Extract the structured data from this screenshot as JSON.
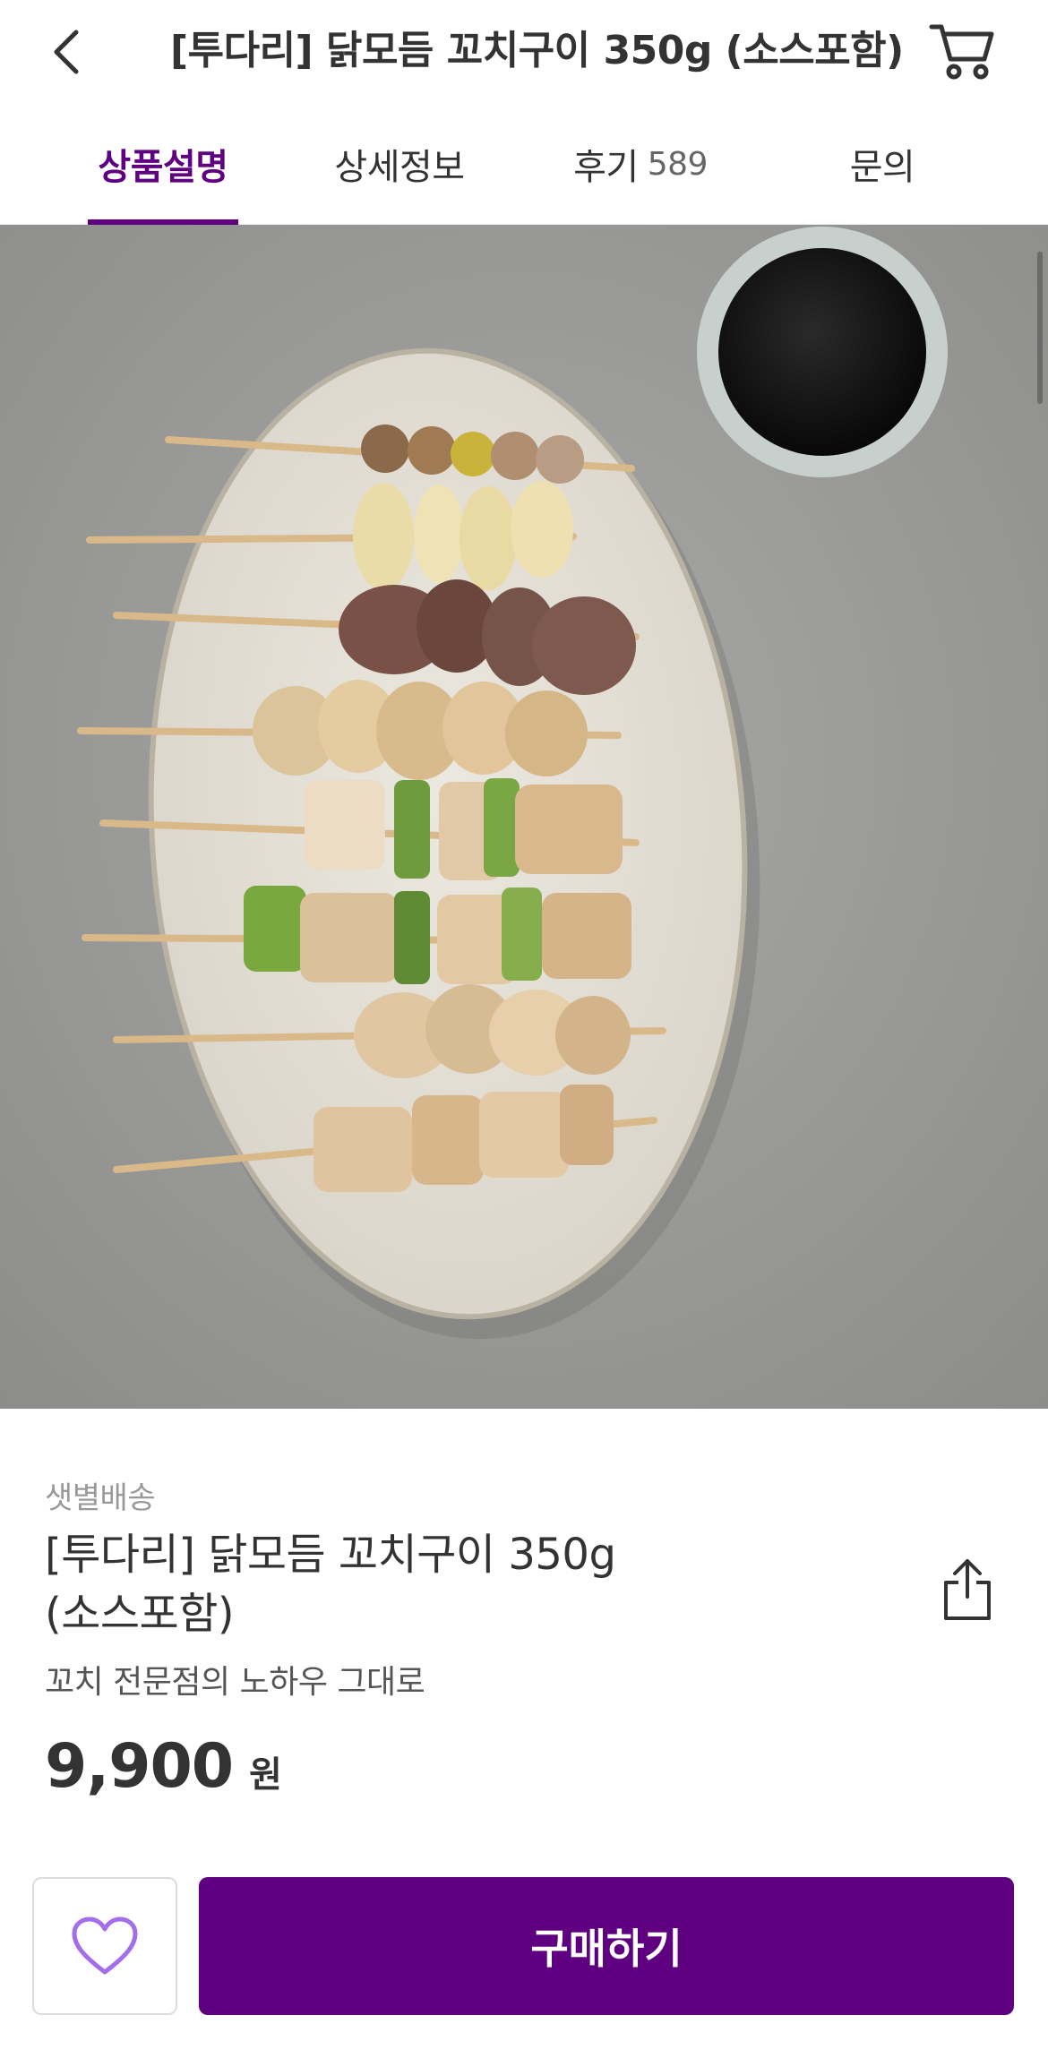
{
  "header": {
    "title": "[투다리] 닭모듬 꼬치구이 350g (소스포함)",
    "back_icon": "chevron-left-icon",
    "cart_icon": "cart-icon"
  },
  "tabs": [
    {
      "label": "상품설명",
      "active": true
    },
    {
      "label": "상세정보",
      "active": false
    },
    {
      "label": "후기",
      "count": "589",
      "active": false
    },
    {
      "label": "문의",
      "active": false
    }
  ],
  "product": {
    "image_alt_icon": "skewer-plate-image",
    "delivery_type": "샛별배송",
    "name_line1": "[투다리] 닭모듬 꼬치구이 350g",
    "name_line2": "(소스포함)",
    "subtitle": "꼬치 전문점의 노하우 그대로",
    "price": "9,900",
    "currency": "원",
    "share_icon": "share-icon"
  },
  "actions": {
    "wish_icon": "heart-icon",
    "buy_label": "구매하기"
  },
  "colors": {
    "brand": "#5f0080",
    "heart": "#a46dea"
  }
}
